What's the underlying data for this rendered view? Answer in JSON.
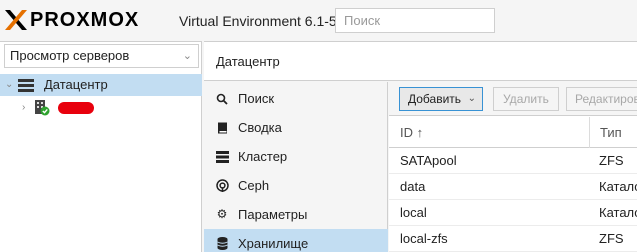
{
  "header": {
    "logo_text": "PROXMOX",
    "version": "Virtual Environment 6.1-5",
    "search_placeholder": "Поиск"
  },
  "left": {
    "view_selector": "Просмотр серверов",
    "tree": {
      "datacenter_label": "Датацентр",
      "node_label_redacted": true
    }
  },
  "main": {
    "title": "Датацентр",
    "nav": [
      {
        "label": "Поиск",
        "icon": "search-icon"
      },
      {
        "label": "Сводка",
        "icon": "book-icon"
      },
      {
        "label": "Кластер",
        "icon": "server-icon"
      },
      {
        "label": "Ceph",
        "icon": "ceph-icon"
      },
      {
        "label": "Параметры",
        "icon": "gear-icon"
      },
      {
        "label": "Хранилище",
        "icon": "database-icon",
        "active": true
      }
    ],
    "toolbar": {
      "add_label": "Добавить",
      "delete_label": "Удалить",
      "edit_label": "Редактировать"
    },
    "grid": {
      "col_id": "ID ↑",
      "col_type": "Тип",
      "rows": [
        {
          "id": "SATApool",
          "type": "ZFS"
        },
        {
          "id": "data",
          "type": "Каталог"
        },
        {
          "id": "local",
          "type": "Каталог"
        },
        {
          "id": "local-zfs",
          "type": "ZFS"
        }
      ]
    }
  },
  "colors": {
    "selection": "#c2ddf2",
    "logo_orange": "#e57000",
    "button_border": "#3892d4",
    "status_green": "#2fa32f",
    "redaction": "#e8000d"
  }
}
